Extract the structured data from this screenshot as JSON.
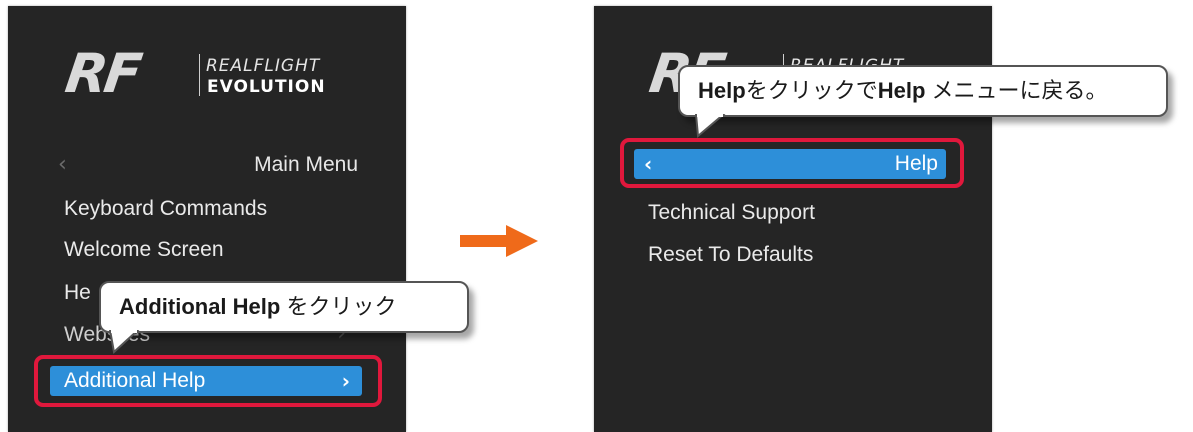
{
  "left_panel": {
    "logo": {
      "mark": "RF",
      "line1": "REALFLIGHT",
      "line2": "EVOLUTION"
    },
    "header": {
      "back_icon": "chevron-left-icon",
      "label": "Main Menu"
    },
    "items": [
      {
        "label": "Keyboard Commands"
      },
      {
        "label": "Welcome Screen"
      },
      {
        "label": "He"
      },
      {
        "label": "Websites"
      }
    ],
    "selected_item": {
      "label": "Additional Help",
      "icon": "chevron-right-icon"
    }
  },
  "right_panel": {
    "logo": {
      "mark": "RF",
      "line1": "REALFLIGHT"
    },
    "selected_header": {
      "label": "Help",
      "icon": "chevron-left-icon"
    },
    "items": [
      {
        "label": "Technical Support"
      },
      {
        "label": "Reset To Defaults"
      }
    ]
  },
  "callouts": {
    "left": {
      "bold": "Additional Help",
      "text": " をクリック"
    },
    "right": {
      "bold1": "Help",
      "text1": "をクリックで",
      "bold2": "Help",
      "text2": " メニューに戻る。"
    }
  },
  "colors": {
    "panel_bg": "#252525",
    "selection_blue": "#2d8fd9",
    "highlight_red": "#e0183c",
    "arrow_orange": "#ef6a1a"
  }
}
